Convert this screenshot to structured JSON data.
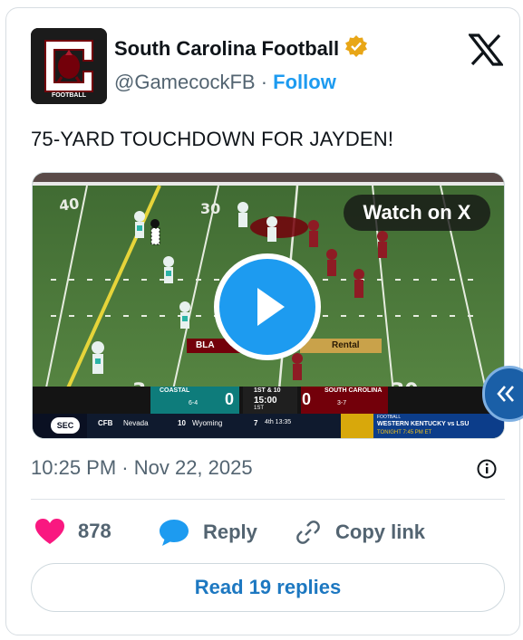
{
  "account": {
    "name": "South Carolina Football",
    "handle": "@GamecockFB",
    "separator": "·",
    "follow_label": "Follow",
    "avatar_caption": "FOOTBALL",
    "verified_color": "#e8a617"
  },
  "tweet": {
    "text": "75-YARD TOUCHDOWN FOR JAYDEN!",
    "timestamp": "10:25 PM · Nov 22, 2025"
  },
  "media": {
    "watch_label": "Watch on X",
    "scoreboard": {
      "away_team": "COASTAL",
      "away_record": "6-4",
      "away_score": "0",
      "down_distance": "1ST & 10",
      "clock": "15:00",
      "quarter": "1ST",
      "timeouts_label": "1 0",
      "home_team": "SOUTH CAROLINA",
      "home_score": "0",
      "home_record": "3-7"
    },
    "ticker": {
      "league": "CFB",
      "item1": "Nevada",
      "item2_score": "10",
      "item2": "Wyoming",
      "item3_score": "7",
      "item3": "4th 13:35",
      "promo_top": "FOOTBALL",
      "promo_main": "WESTERN KENTUCKY vs LSU",
      "promo_time": "TONIGHT 7:45 PM ET"
    },
    "banner_left": "BLA",
    "banner_right": "Rental"
  },
  "actions": {
    "like_count": "878",
    "reply_label": "Reply",
    "copy_label": "Copy link",
    "read_replies_label": "Read 19 replies"
  },
  "colors": {
    "accent": "#1d9bf0",
    "like": "#f91880",
    "field_green": "#4f7a3a",
    "gamecock_garnet": "#73000a"
  }
}
